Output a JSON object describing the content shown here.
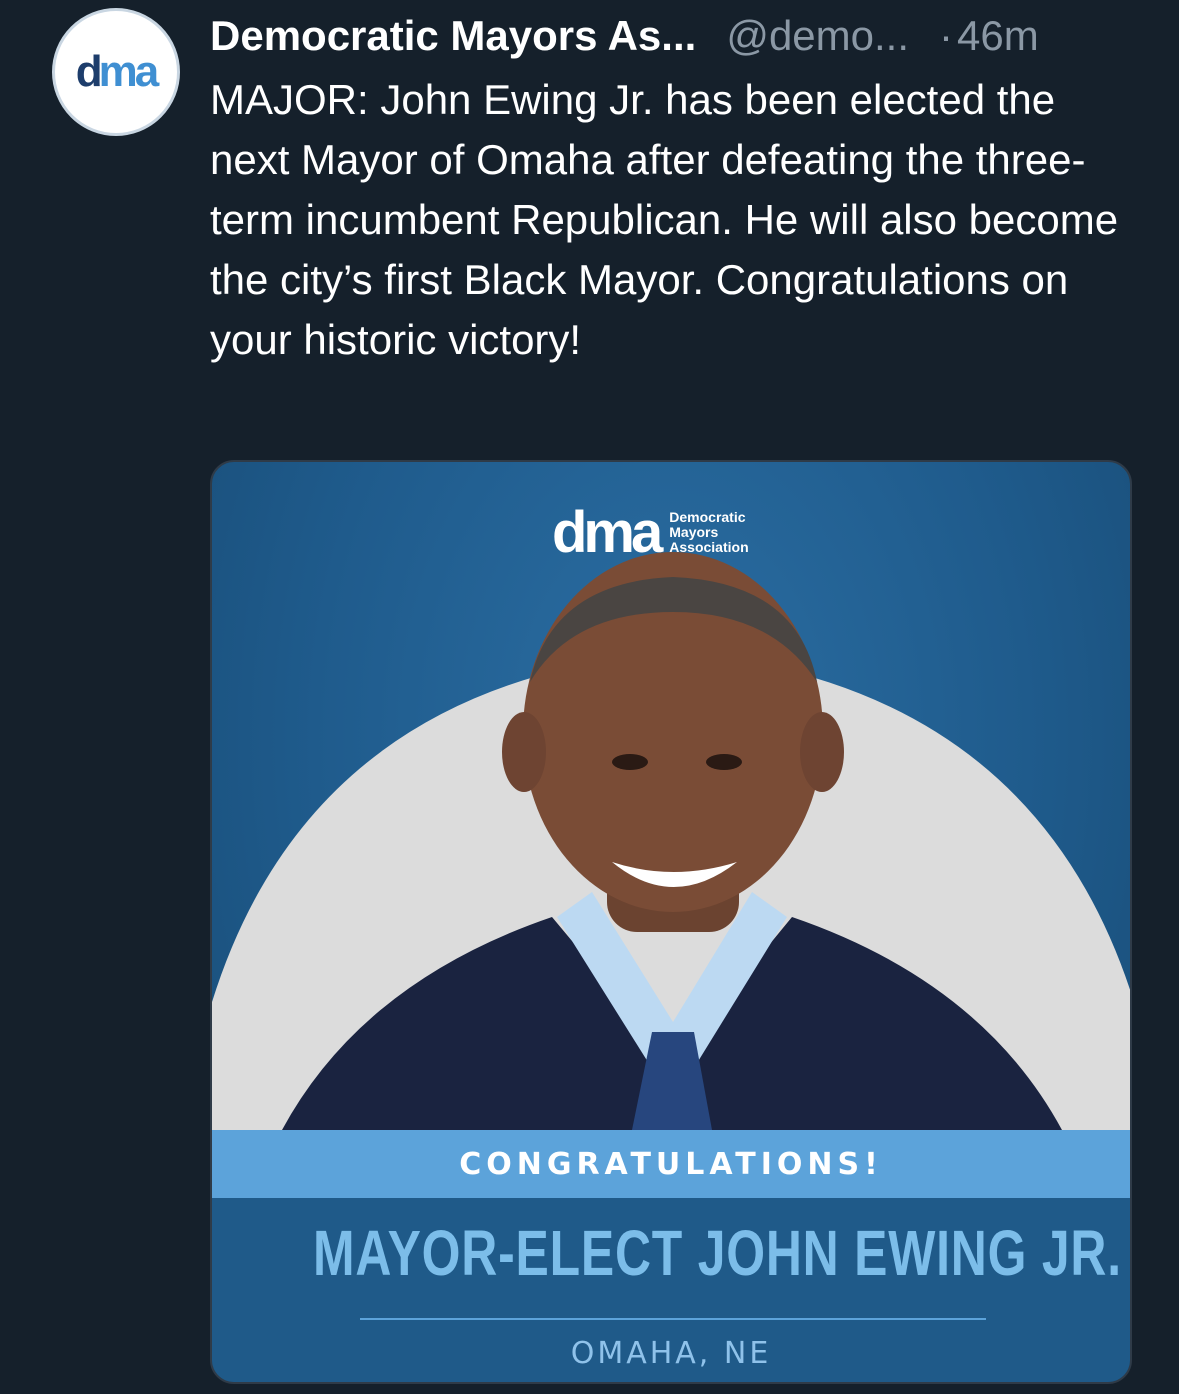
{
  "tweet": {
    "author_name": "Democratic Mayors As...",
    "handle": "@demo...",
    "separator": "·",
    "time": "46m",
    "avatar_text": [
      "d",
      "ma"
    ],
    "text": "MAJOR: John Ewing Jr. has been elected the next Mayor of Omaha after defeating the three-term incumbent Republican. He will also become the city’s first Black Mayor. Congratulations on your historic victory!"
  },
  "media": {
    "logo_mark": "dma",
    "logo_org_line1": "Democratic",
    "logo_org_line2": "Mayors",
    "logo_org_line3": "Association",
    "banner": "CONGRATULATIONS!",
    "headline": "MAYOR-ELECT JOHN EWING JR.",
    "location": "OMAHA, NE"
  },
  "colors": {
    "background": "#15202b",
    "text_primary": "#ffffff",
    "text_secondary": "#8b98a5",
    "media_blue": "#1f5b8c",
    "band_blue": "#5ca3da",
    "headline_blue": "#7cbde9"
  }
}
